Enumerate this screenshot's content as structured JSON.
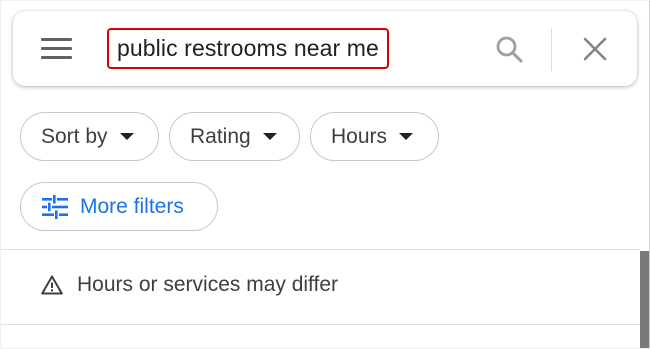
{
  "search": {
    "query": "public restrooms near me",
    "menu_icon": "hamburger-menu-icon",
    "search_icon": "magnifier-icon",
    "clear_icon": "close-x-icon",
    "highlight_color": "#e00000"
  },
  "filters": {
    "chips": [
      {
        "label": "Sort by"
      },
      {
        "label": "Rating"
      },
      {
        "label": "Hours"
      }
    ],
    "more_filters_label": "More filters",
    "more_filters_icon": "sliders-tune-icon",
    "accent_color": "#1a73e8"
  },
  "notice": {
    "text": "Hours or services may differ",
    "icon": "warning-triangle-icon"
  }
}
